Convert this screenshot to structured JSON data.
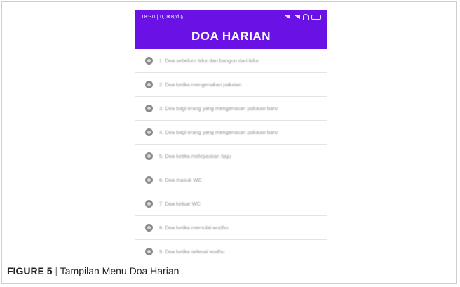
{
  "status_bar": {
    "time_text": "18:30 | 0,0KB/d §"
  },
  "app_bar": {
    "title": "DOA HARIAN"
  },
  "menu_items": [
    {
      "label": "1. Doa sebelum tidur dan bangun dari tidur"
    },
    {
      "label": "2. Doa ketika mengenakan pakaian"
    },
    {
      "label": "3. Doa bagi orang yang mengenakan pakaian baru"
    },
    {
      "label": "4. Doa bagi orang yang mengenakan pakaian baru"
    },
    {
      "label": "5. Doa ketika melepaskan baju"
    },
    {
      "label": "6. Doa masuk WC"
    },
    {
      "label": "7. Doa keluar WC"
    },
    {
      "label": "8. Doa ketika memulai wudhu"
    },
    {
      "label": "9. Doa ketika selesai wudhu"
    }
  ],
  "caption": {
    "label": "FIGURE 5",
    "separator": "|",
    "text": "Tampilan Menu Doa Harian"
  },
  "colors": {
    "header_purple": "#6a12e6",
    "item_text": "#8c8c8c",
    "divider": "#e4e4e4"
  },
  "icons": {
    "status": [
      "signal-icon",
      "wifi-icon",
      "battery-icon"
    ],
    "item": "circle-info-icon"
  }
}
